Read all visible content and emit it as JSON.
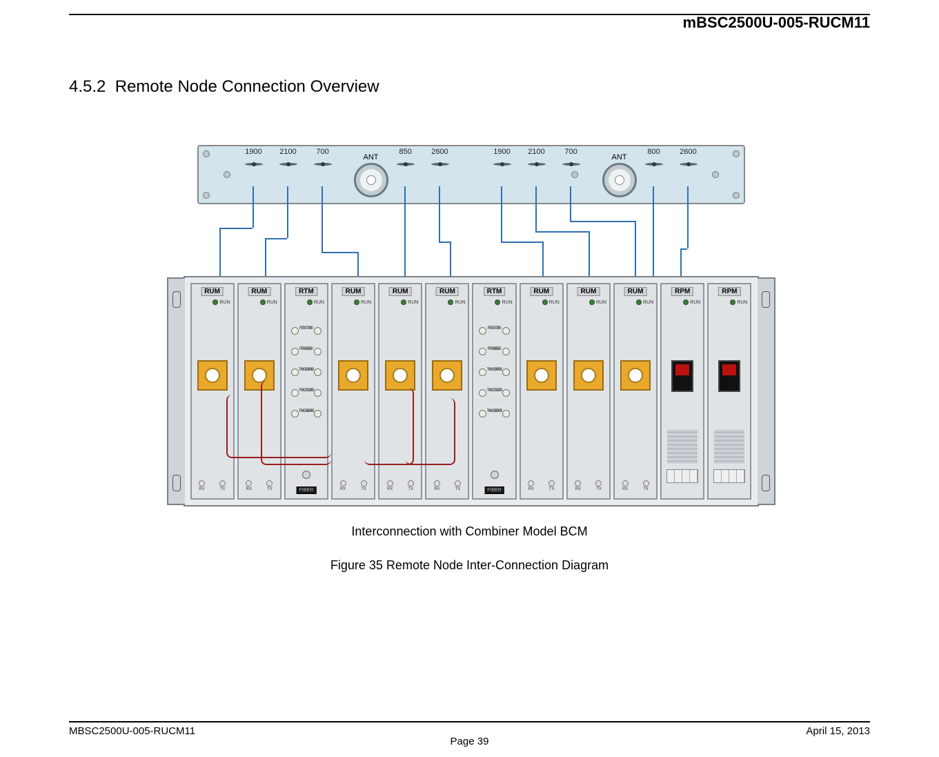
{
  "header": {
    "doc_code_top": "mBSC2500U-005-RUCM11"
  },
  "section": {
    "number": "4.5.2",
    "title": "Remote Node Connection Overview"
  },
  "top_panel": {
    "ant_label": "ANT",
    "ports_left": [
      {
        "label": "1900"
      },
      {
        "label": "2100"
      },
      {
        "label": "700"
      }
    ],
    "ports_mid_left": [
      {
        "label": "850"
      },
      {
        "label": "2600"
      }
    ],
    "ports_mid_right": [
      {
        "label": "1900"
      },
      {
        "label": "2100"
      },
      {
        "label": "700"
      }
    ],
    "ports_right": [
      {
        "label": "800"
      },
      {
        "label": "2600"
      }
    ]
  },
  "chassis": {
    "run_label": "RUN",
    "fiber_label": "FIBER",
    "rx_label": "RX",
    "tx_label": "TX",
    "cards": [
      {
        "tag": "RUM"
      },
      {
        "tag": "RUM"
      },
      {
        "tag": "RTM"
      },
      {
        "tag": "RUM"
      },
      {
        "tag": "RUM"
      },
      {
        "tag": "RUM"
      },
      {
        "tag": "RTM"
      },
      {
        "tag": "RUM"
      },
      {
        "tag": "RUM"
      },
      {
        "tag": "RUM"
      },
      {
        "tag": "RPM"
      },
      {
        "tag": "RPM"
      }
    ],
    "rtm_rows": [
      {
        "l": "RX700",
        "r": "TX700"
      },
      {
        "l": "RX850",
        "r": "TX850"
      },
      {
        "l": "RX1900",
        "r": "TX1900"
      },
      {
        "l": "RX2100",
        "r": "TX2100"
      },
      {
        "l": "RX2600",
        "r": "TX2600"
      }
    ]
  },
  "captions": {
    "sub": "Interconnection with Combiner Model BCM",
    "fig": "Figure 35 Remote Node Inter-Connection Diagram"
  },
  "footer": {
    "left": "MBSC2500U-005-RUCM11",
    "right": "April 15, 2013",
    "page": "Page 39"
  }
}
